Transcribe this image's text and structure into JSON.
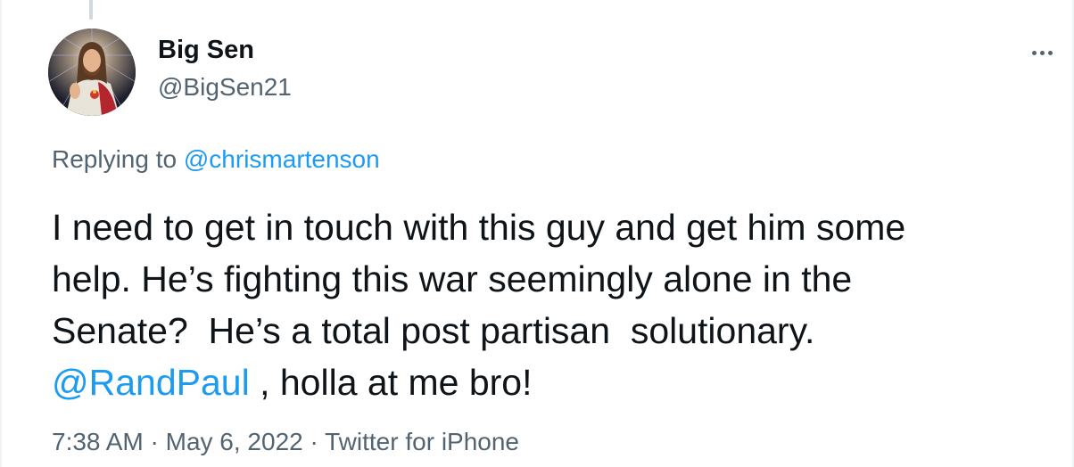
{
  "tweet": {
    "author": {
      "name": "Big Sen",
      "handle": "@BigSen21",
      "avatar_icon": "avatar-icon"
    },
    "more_icon": "more-horizontal-icon",
    "reply_to": {
      "prefix": "Replying to ",
      "mention": "@chrismartenson"
    },
    "text_lines": [
      "I need to get in touch with this guy and get him some",
      "help. He’s fighting this war seemingly alone in the",
      "Senate?  He’s a total post partisan  solutionary."
    ],
    "last_line": {
      "mention": "@RandPaul",
      "rest": " , holla at me bro!"
    },
    "meta": {
      "time": "7:38 AM",
      "sep1": " · ",
      "date": "May 6, 2022",
      "sep2": " · ",
      "source": "Twitter for iPhone"
    }
  },
  "colors": {
    "text": "#0f1419",
    "secondary": "#536471",
    "link": "#1d9bf0",
    "thread_line": "#cfd9de"
  }
}
